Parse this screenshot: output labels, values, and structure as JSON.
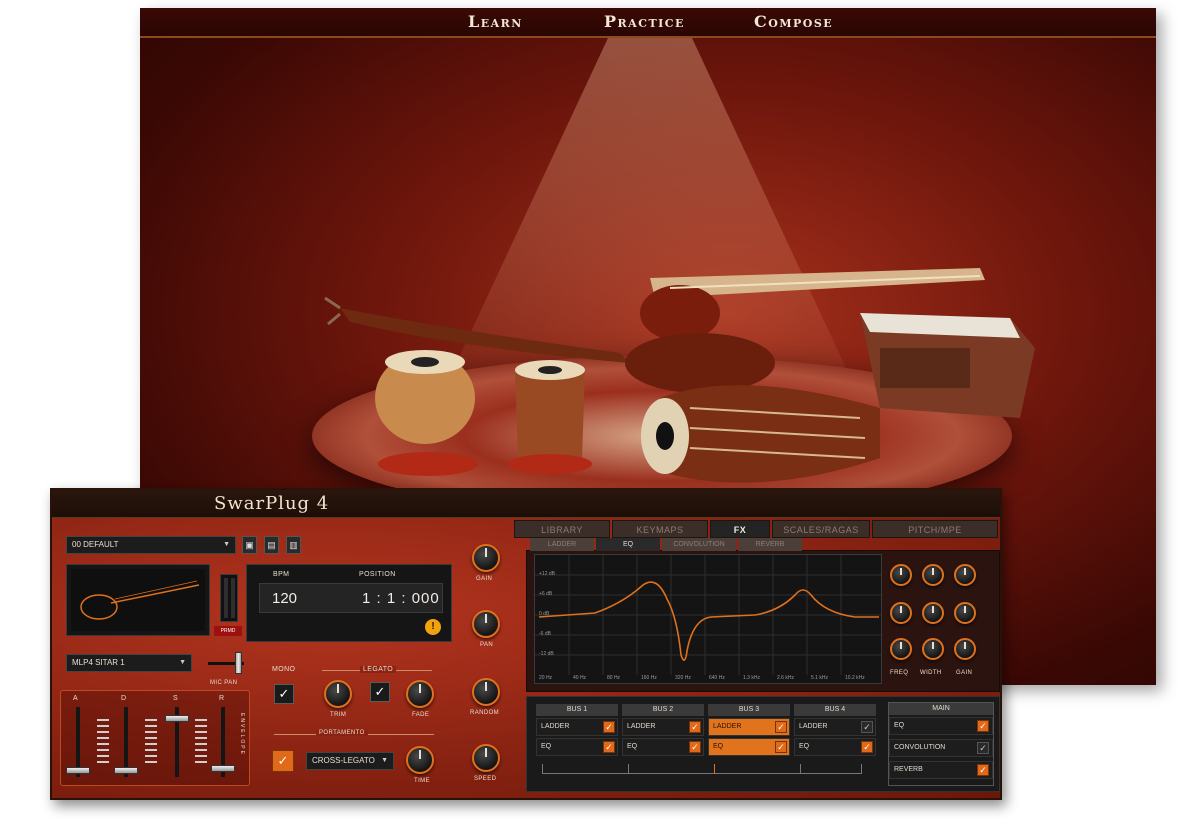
{
  "splash": {
    "nav": [
      "Learn",
      "Practice",
      "Compose"
    ]
  },
  "plugin": {
    "title": "SwarPlug 4",
    "tabs": [
      "LIBRARY",
      "KEYMAPS",
      "FX",
      "SCALES/RAGAS",
      "PITCH/MPE"
    ],
    "active_tab": "FX",
    "fx_subtabs": [
      "LADDER",
      "EQ",
      "CONVOLUTION",
      "REVERB"
    ],
    "active_subtab": "EQ",
    "preset": "00 DEFAULT",
    "bpm_label": "BPM",
    "bpm_value": "120",
    "position_label": "POSITION",
    "position_value": "1 : 1 : 000",
    "prmd_label": "PRMD",
    "instrument": "MLP4 SITAR 1",
    "mic_pan_label": "MIC PAN",
    "knob_labels": [
      "GAIN",
      "PAN",
      "RANDOM",
      "SPEED"
    ],
    "mono_label": "MONO",
    "legato_label": "LEGATO",
    "trim_label": "TRIM",
    "fade_label": "FADE",
    "portamento_label": "PORTAMENTO",
    "portamento_mode": "CROSS-LEGATO",
    "time_label": "TIME",
    "envelope_label": "ENVELOPE",
    "adsr_labels": [
      "A",
      "D",
      "S",
      "R"
    ],
    "eq_y_labels": [
      "+12 dB",
      "+6 dB",
      "0 dB",
      "-6 dB",
      "-12 dB"
    ],
    "eq_x_labels": [
      "20 Hz",
      "40 Hz",
      "80 Hz",
      "160 Hz",
      "320 Hz",
      "640 Hz",
      "1.3 kHz",
      "2.6 kHz",
      "5.1 kHz",
      "10.2 kHz"
    ],
    "eq_knob_labels": [
      "FREQ",
      "WIDTH",
      "GAIN"
    ],
    "buses": [
      {
        "name": "BUS 1",
        "rows": [
          {
            "label": "LADDER",
            "checked": true
          },
          {
            "label": "EQ",
            "checked": true
          }
        ]
      },
      {
        "name": "BUS 2",
        "rows": [
          {
            "label": "LADDER",
            "checked": true
          },
          {
            "label": "EQ",
            "checked": true
          }
        ]
      },
      {
        "name": "BUS 3",
        "rows": [
          {
            "label": "LADDER",
            "checked": true
          },
          {
            "label": "EQ",
            "checked": true
          }
        ]
      },
      {
        "name": "BUS 4",
        "rows": [
          {
            "label": "LADDER",
            "checked": false
          },
          {
            "label": "EQ",
            "checked": true
          }
        ]
      }
    ],
    "main": {
      "name": "MAIN",
      "rows": [
        {
          "label": "EQ",
          "checked": true
        },
        {
          "label": "CONVOLUTION",
          "checked": false
        },
        {
          "label": "REVERB",
          "checked": true
        }
      ]
    },
    "accent_color": "#e0701c"
  }
}
